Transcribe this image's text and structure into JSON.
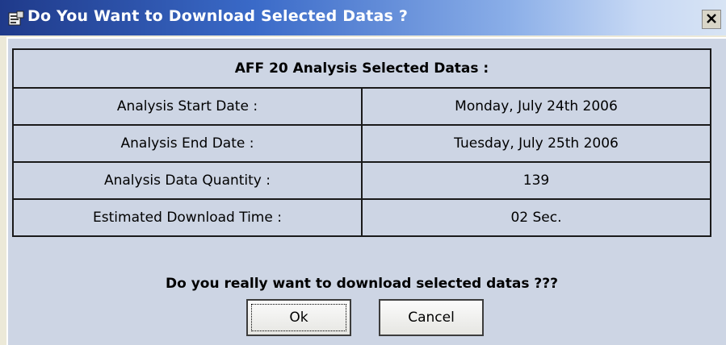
{
  "window": {
    "title": "Do You Want to Download Selected Datas ?",
    "icon": "window-app-icon",
    "close_icon": "close-icon"
  },
  "table": {
    "header": "AFF 20 Analysis Selected Datas :",
    "rows": [
      {
        "label": "Analysis Start Date :",
        "value": "Monday, July 24th 2006"
      },
      {
        "label": "Analysis End Date :",
        "value": "Tuesday, July 25th 2006"
      },
      {
        "label": "Analysis Data Quantity :",
        "value": "139"
      },
      {
        "label": "Estimated Download Time :",
        "value": "02 Sec."
      }
    ]
  },
  "question": "Do you really want to download selected datas ???",
  "buttons": {
    "ok": "Ok",
    "cancel": "Cancel"
  }
}
